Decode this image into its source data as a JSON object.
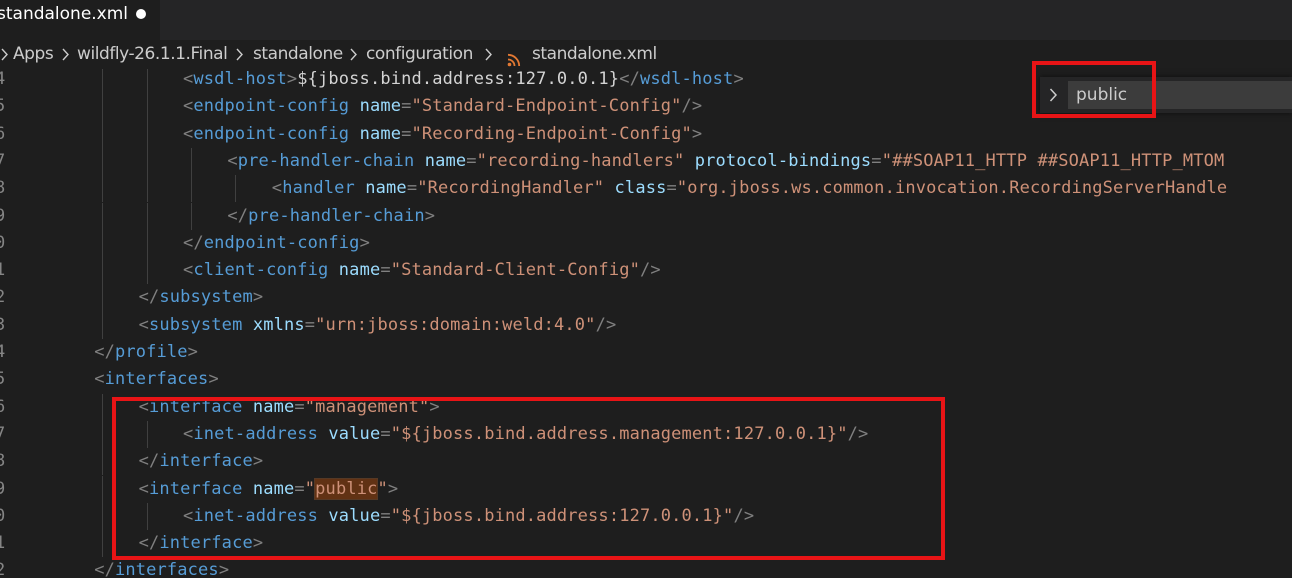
{
  "tab": {
    "title": "standalone.xml",
    "dirty_indicator": "●"
  },
  "breadcrumb": {
    "items": [
      "Apps",
      "wildfly-26.1.1.Final",
      "standalone",
      "configuration",
      "standalone.xml"
    ],
    "separator_icon": "chevron-right-icon",
    "file_icon": "rss-icon"
  },
  "find_widget": {
    "query": "public",
    "toggle_icon": "chevron-right-icon"
  },
  "editor": {
    "line_numbers": [
      "4",
      "5",
      "6",
      "7",
      "8",
      "9",
      "0",
      "1",
      "2",
      "3",
      "4",
      "5",
      "6",
      "7",
      "8",
      "9",
      "0",
      "1",
      "2"
    ],
    "lines": [
      {
        "indent": 4,
        "tokens": [
          [
            "p",
            "<"
          ],
          [
            "tag",
            "wsdl-host"
          ],
          [
            "p",
            ">"
          ],
          [
            "txt",
            "${jboss.bind.address:127.0.0.1}"
          ],
          [
            "p",
            "</"
          ],
          [
            "tag",
            "wsdl-host"
          ],
          [
            "p",
            ">"
          ]
        ]
      },
      {
        "indent": 4,
        "tokens": [
          [
            "p",
            "<"
          ],
          [
            "tag",
            "endpoint-config"
          ],
          [
            "txt",
            " "
          ],
          [
            "attr",
            "name"
          ],
          [
            "p",
            "="
          ],
          [
            "str",
            "\"Standard-Endpoint-Config\""
          ],
          [
            "p",
            "/>"
          ]
        ]
      },
      {
        "indent": 4,
        "tokens": [
          [
            "p",
            "<"
          ],
          [
            "tag",
            "endpoint-config"
          ],
          [
            "txt",
            " "
          ],
          [
            "attr",
            "name"
          ],
          [
            "p",
            "="
          ],
          [
            "str",
            "\"Recording-Endpoint-Config\""
          ],
          [
            "p",
            ">"
          ]
        ]
      },
      {
        "indent": 5,
        "tokens": [
          [
            "p",
            "<"
          ],
          [
            "tag",
            "pre-handler-chain"
          ],
          [
            "txt",
            " "
          ],
          [
            "attr",
            "name"
          ],
          [
            "p",
            "="
          ],
          [
            "str",
            "\"recording-handlers\""
          ],
          [
            "txt",
            " "
          ],
          [
            "attr",
            "protocol-bindings"
          ],
          [
            "p",
            "="
          ],
          [
            "str",
            "\"##SOAP11_HTTP ##SOAP11_HTTP_MTOM"
          ]
        ]
      },
      {
        "indent": 6,
        "tokens": [
          [
            "p",
            "<"
          ],
          [
            "tag",
            "handler"
          ],
          [
            "txt",
            " "
          ],
          [
            "attr",
            "name"
          ],
          [
            "p",
            "="
          ],
          [
            "str",
            "\"RecordingHandler\""
          ],
          [
            "txt",
            " "
          ],
          [
            "attr",
            "class"
          ],
          [
            "p",
            "="
          ],
          [
            "str",
            "\"org.jboss.ws.common.invocation.RecordingServerHandle"
          ]
        ]
      },
      {
        "indent": 5,
        "tokens": [
          [
            "p",
            "</"
          ],
          [
            "tag",
            "pre-handler-chain"
          ],
          [
            "p",
            ">"
          ]
        ]
      },
      {
        "indent": 4,
        "tokens": [
          [
            "p",
            "</"
          ],
          [
            "tag",
            "endpoint-config"
          ],
          [
            "p",
            ">"
          ]
        ]
      },
      {
        "indent": 4,
        "tokens": [
          [
            "p",
            "<"
          ],
          [
            "tag",
            "client-config"
          ],
          [
            "txt",
            " "
          ],
          [
            "attr",
            "name"
          ],
          [
            "p",
            "="
          ],
          [
            "str",
            "\"Standard-Client-Config\""
          ],
          [
            "p",
            "/>"
          ]
        ]
      },
      {
        "indent": 3,
        "tokens": [
          [
            "p",
            "</"
          ],
          [
            "tag",
            "subsystem"
          ],
          [
            "p",
            ">"
          ]
        ]
      },
      {
        "indent": 3,
        "tokens": [
          [
            "p",
            "<"
          ],
          [
            "tag",
            "subsystem"
          ],
          [
            "txt",
            " "
          ],
          [
            "attr",
            "xmlns"
          ],
          [
            "p",
            "="
          ],
          [
            "str",
            "\"urn:jboss:domain:weld:4.0\""
          ],
          [
            "p",
            "/>"
          ]
        ]
      },
      {
        "indent": 2,
        "tokens": [
          [
            "p",
            "</"
          ],
          [
            "tag",
            "profile"
          ],
          [
            "p",
            ">"
          ]
        ]
      },
      {
        "indent": 2,
        "tokens": [
          [
            "p",
            "<"
          ],
          [
            "tag",
            "interfaces"
          ],
          [
            "p",
            ">"
          ]
        ]
      },
      {
        "indent": 3,
        "tokens": [
          [
            "p",
            "<"
          ],
          [
            "tag",
            "interface"
          ],
          [
            "txt",
            " "
          ],
          [
            "attr",
            "name"
          ],
          [
            "p",
            "="
          ],
          [
            "str",
            "\"management\""
          ],
          [
            "p",
            ">"
          ]
        ]
      },
      {
        "indent": 4,
        "tokens": [
          [
            "p",
            "<"
          ],
          [
            "tag",
            "inet-address"
          ],
          [
            "txt",
            " "
          ],
          [
            "attr",
            "value"
          ],
          [
            "p",
            "="
          ],
          [
            "str",
            "\"${jboss.bind.address.management:127.0.0.1}\""
          ],
          [
            "p",
            "/>"
          ]
        ]
      },
      {
        "indent": 3,
        "tokens": [
          [
            "p",
            "</"
          ],
          [
            "tag",
            "interface"
          ],
          [
            "p",
            ">"
          ]
        ]
      },
      {
        "indent": 3,
        "tokens": [
          [
            "p",
            "<"
          ],
          [
            "tag",
            "interface"
          ],
          [
            "txt",
            " "
          ],
          [
            "attr",
            "name"
          ],
          [
            "p",
            "="
          ],
          [
            "str",
            "\""
          ],
          [
            "hl",
            "public"
          ],
          [
            "str",
            "\""
          ],
          [
            "p",
            ">"
          ]
        ]
      },
      {
        "indent": 4,
        "tokens": [
          [
            "p",
            "<"
          ],
          [
            "tag",
            "inet-address"
          ],
          [
            "txt",
            " "
          ],
          [
            "attr",
            "value"
          ],
          [
            "p",
            "="
          ],
          [
            "str",
            "\"${jboss.bind.address:127.0.0.1}\""
          ],
          [
            "p",
            "/>"
          ]
        ]
      },
      {
        "indent": 3,
        "tokens": [
          [
            "p",
            "</"
          ],
          [
            "tag",
            "interface"
          ],
          [
            "p",
            ">"
          ]
        ]
      },
      {
        "indent": 2,
        "tokens": [
          [
            "p",
            "</"
          ],
          [
            "tag",
            "interfaces"
          ],
          [
            "p",
            ">"
          ]
        ]
      }
    ]
  },
  "colors": {
    "editor_background": "#1e1e1e",
    "tag": "#569cd6",
    "attribute": "#9cdcfe",
    "string": "#ce9178",
    "punctuation": "#808080",
    "text": "#d4d4d4",
    "line_number": "#858585",
    "find_match_highlight": "#613214",
    "annotation_red": "#e81416"
  }
}
